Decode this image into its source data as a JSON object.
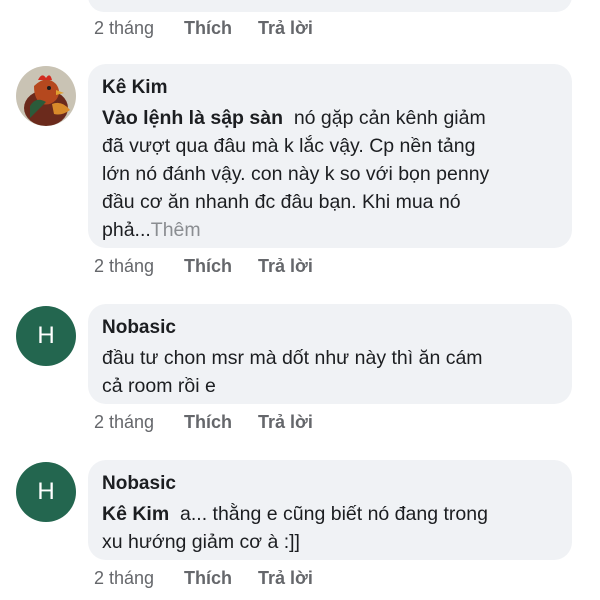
{
  "top_actions": {
    "time": "2 tháng",
    "like": "Thích",
    "reply": "Trả lời"
  },
  "comments": [
    {
      "author": "Kê Kim",
      "avatar": "rooster-avatar",
      "mention": "Vào lệnh là sập sàn",
      "line1_rest": "  nó gặp cản kênh giảm",
      "line2": "đã vượt qua đâu mà k lắc vậy. Cp nền tảng",
      "line3": "lớn nó đánh vậy. con này k so với bọn penny",
      "line4": "đầu cơ ăn nhanh đc đâu bạn. Khi mua nó",
      "line5": "phả...",
      "see_more": "Thêm",
      "time": "2 tháng",
      "like": "Thích",
      "reply": "Trả lời"
    },
    {
      "author": "Nobasic",
      "avatar_letter": "H",
      "line1": "đầu tư chon msr mà dốt như này thì ăn cám",
      "line2": "cả room rồi e",
      "time": "2 tháng",
      "like": "Thích",
      "reply": "Trả lời"
    },
    {
      "author": "Nobasic",
      "avatar_letter": "H",
      "mention": "Kê Kim",
      "line1_rest": "  a... thằng e cũng biết nó đang trong",
      "line2": "xu hướng giảm cơ à :]]",
      "time": "2 tháng",
      "like": "Thích",
      "reply": "Trả lời"
    }
  ],
  "colors": {
    "bubble": "#f0f2f5",
    "avatar_h": "#23664f",
    "meta_text": "#65676b"
  }
}
